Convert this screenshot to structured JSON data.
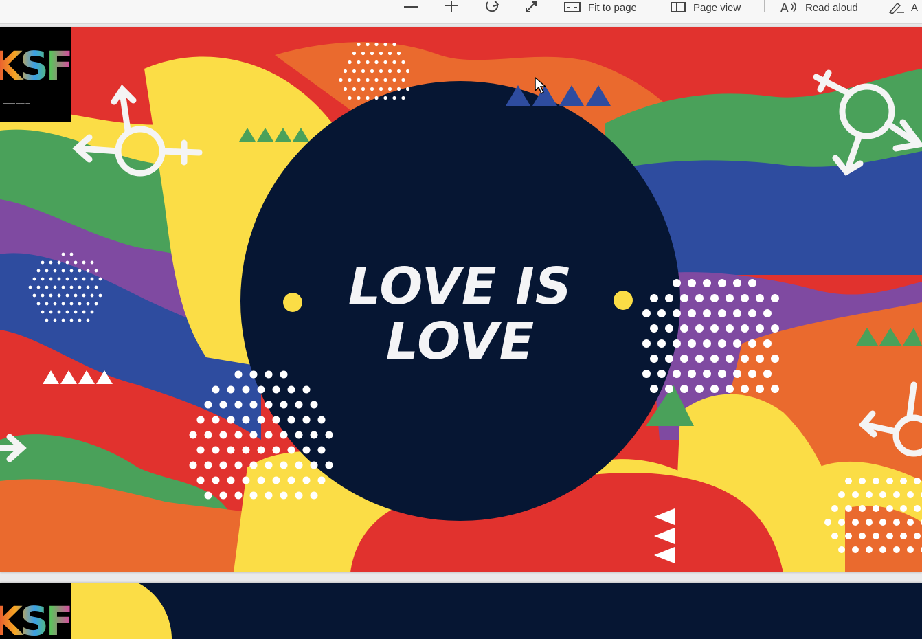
{
  "toolbar": {
    "items": [
      {
        "icon": "zoom-out-icon"
      },
      {
        "icon": "zoom-in-icon"
      },
      {
        "icon": "rotate-icon"
      },
      {
        "icon": "fullscreen-icon"
      },
      {
        "icon": "fit-to-page-icon",
        "label": "Fit to page"
      },
      {
        "icon": "page-view-icon",
        "label": "Page view"
      },
      {
        "icon": "read-aloud-icon",
        "label": "Read aloud"
      },
      {
        "icon": "draw-icon"
      },
      {
        "icon": "text-icon",
        "label": "A"
      }
    ]
  },
  "document": {
    "page1": {
      "logo_text": "KSF",
      "headline_line1": "LOVE IS",
      "headline_line2": "LOVE"
    },
    "page2": {
      "logo_text": "KSF"
    }
  },
  "colors": {
    "navy": "#061633",
    "red": "#e1322e",
    "orange": "#ea6a2e",
    "yellow": "#fbdd46",
    "green": "#4aa15a",
    "blue": "#2e4c9f",
    "purple": "#7f4aa1",
    "white": "#ffffff"
  }
}
